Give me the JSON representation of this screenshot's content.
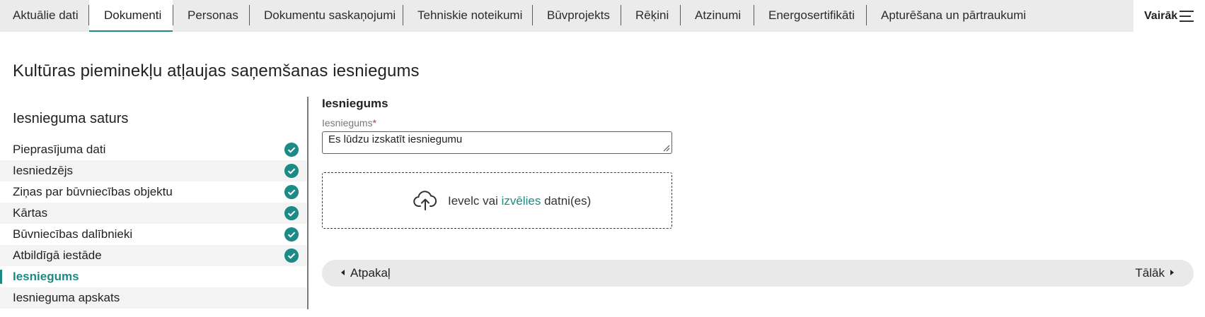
{
  "tabs": [
    {
      "label": "Aktuālie dati",
      "active": false
    },
    {
      "label": "Dokumenti",
      "active": true
    },
    {
      "label": "Personas",
      "active": false
    },
    {
      "label": "Dokumentu saskaņojumi",
      "active": false
    },
    {
      "label": "Tehniskie noteikumi",
      "active": false
    },
    {
      "label": "Būvprojekts",
      "active": false
    },
    {
      "label": "Rēķini",
      "active": false
    },
    {
      "label": "Atzinumi",
      "active": false
    },
    {
      "label": "Energosertifikāti",
      "active": false
    },
    {
      "label": "Apturēšana un pārtraukumi",
      "active": false
    }
  ],
  "more": {
    "label": "Vairāk",
    "icon": "menu-lines-icon"
  },
  "page": {
    "title": "Kultūras pieminekļu atļaujas saņemšanas iesniegums"
  },
  "sidebar": {
    "title": "Iesnieguma saturs",
    "steps": [
      {
        "label": "Pieprasījuma dati",
        "completed": true
      },
      {
        "label": "Iesniedzējs",
        "completed": true
      },
      {
        "label": "Ziņas par būvniecības objektu",
        "completed": true
      },
      {
        "label": "Kārtas",
        "completed": true
      },
      {
        "label": "Būvniecības dalībnieki",
        "completed": true
      },
      {
        "label": "Atbildīgā iestāde",
        "completed": true
      },
      {
        "label": "Iesniegums",
        "completed": false,
        "current": true
      },
      {
        "label": "Iesnieguma apskats",
        "completed": false
      }
    ]
  },
  "form": {
    "section_title": "Iesniegums",
    "field_label": "Iesniegums",
    "required_marker": "*",
    "field_value": "Es lūdzu izskatīt iesniegumu"
  },
  "upload": {
    "text_before": "Ievelc vai",
    "link_text": "izvēlies",
    "text_after": "datni(es)",
    "icon": "cloud-upload-icon"
  },
  "navigation": {
    "back_label": "Atpakaļ",
    "next_label": "Tālāk"
  },
  "colors": {
    "accent": "#1c8a86",
    "tabbar_bg": "#ebebeb",
    "required": "#c0392b"
  }
}
